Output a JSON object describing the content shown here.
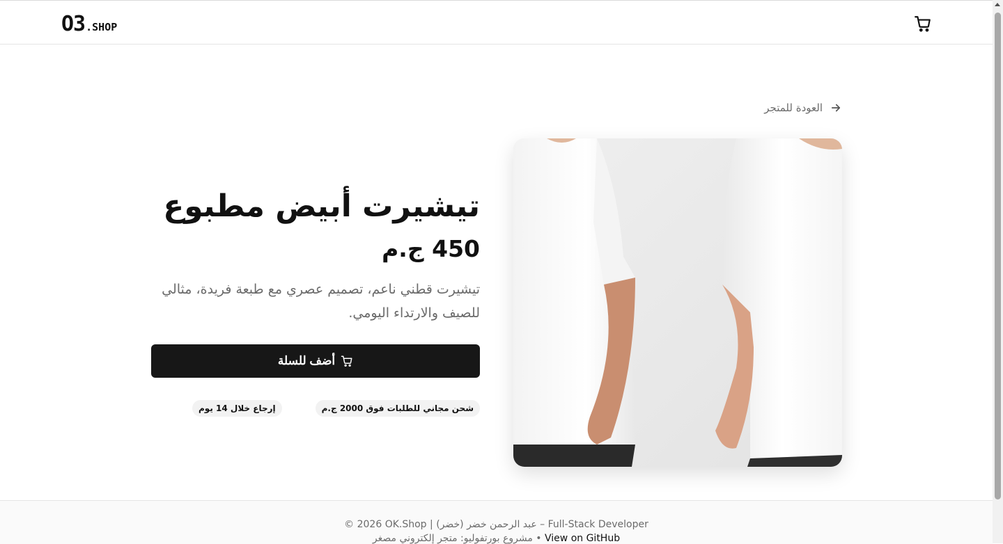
{
  "header": {
    "logo_main": "O3",
    "logo_suffix": ".SHOP",
    "cart_icon": "cart-icon"
  },
  "nav": {
    "back_label": "العودة للمتجر",
    "back_icon": "arrow-right-icon"
  },
  "product": {
    "title": "تيشيرت أبيض مطبوع",
    "price": "450 ج.م",
    "description": "تيشيرت قطني ناعم، تصميم عصري مع طبعة فريدة، مثالي للصيف والارتداء اليومي.",
    "image_alt": "تيشيرت أبيض مطبوع",
    "add_to_cart_label": "أضف للسلة",
    "badges": [
      "شحن مجاني للطلبات فوق 2000 ج.م",
      "إرجاع خلال 14 يوم"
    ]
  },
  "footer": {
    "line1": "© 2026 OK.Shop | عبد الرحمن خضر (خضر) – Full-Stack Developer",
    "line2_text": "مشروع بورتفوليو: متجر إلكتروني مصغر •",
    "github_label": "View on GitHub"
  },
  "colors": {
    "button_bg": "#171717",
    "muted_text": "#6b6b6b",
    "badge_bg": "#f2f2f2"
  }
}
